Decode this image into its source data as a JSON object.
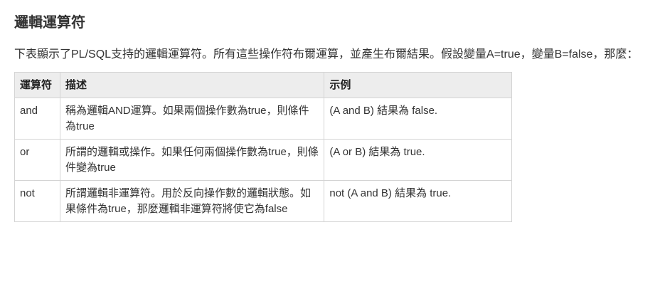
{
  "section": {
    "title": "邏輯運算符",
    "intro": "下表顯示了PL/SQL支持的邏輯運算符。所有這些操作符布爾運算，並產生布爾結果。假設變量A=true，變量B=false，那麼："
  },
  "table": {
    "headers": [
      "運算符",
      "描述",
      "示例"
    ],
    "rows": [
      {
        "operator": "and",
        "description": "稱為邏輯AND運算。如果兩個操作數為true，則條件為true",
        "example": "(A and B) 結果為 false."
      },
      {
        "operator": "or",
        "description": "所謂的邏輯或操作。如果任何兩個操作數為true，則條件變為true",
        "example": "(A or B) 結果為 true."
      },
      {
        "operator": "not",
        "description": "所謂邏輯非運算符。用於反向操作數的邏輯狀態。如果條件為true，那麼邏輯非運算符將使它為false",
        "example": "not (A and B) 結果為 true."
      }
    ]
  }
}
